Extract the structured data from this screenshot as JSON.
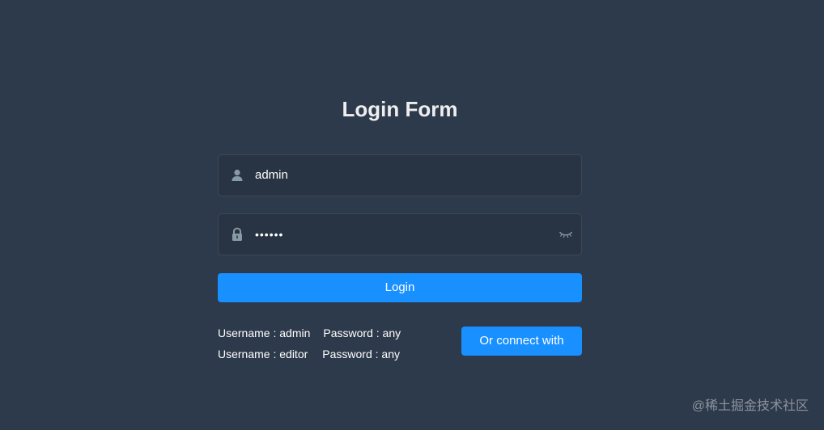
{
  "page": {
    "title": "Login Form"
  },
  "form": {
    "username": {
      "icon": "user-icon",
      "value": "admin"
    },
    "password": {
      "icon": "lock-icon",
      "value": "••••••",
      "toggle_icon": "eye-closed-icon"
    },
    "login_button": "Login"
  },
  "tips": [
    {
      "username": "Username : admin",
      "password": "Password : any"
    },
    {
      "username": "Username : editor",
      "password": "Password : any"
    }
  ],
  "connect_button": "Or connect with",
  "watermark": "@稀土掘金技术社区",
  "colors": {
    "background": "#2d3a4b",
    "accent": "#1890ff",
    "icon": "#889aa4",
    "title": "#eeeeee"
  }
}
